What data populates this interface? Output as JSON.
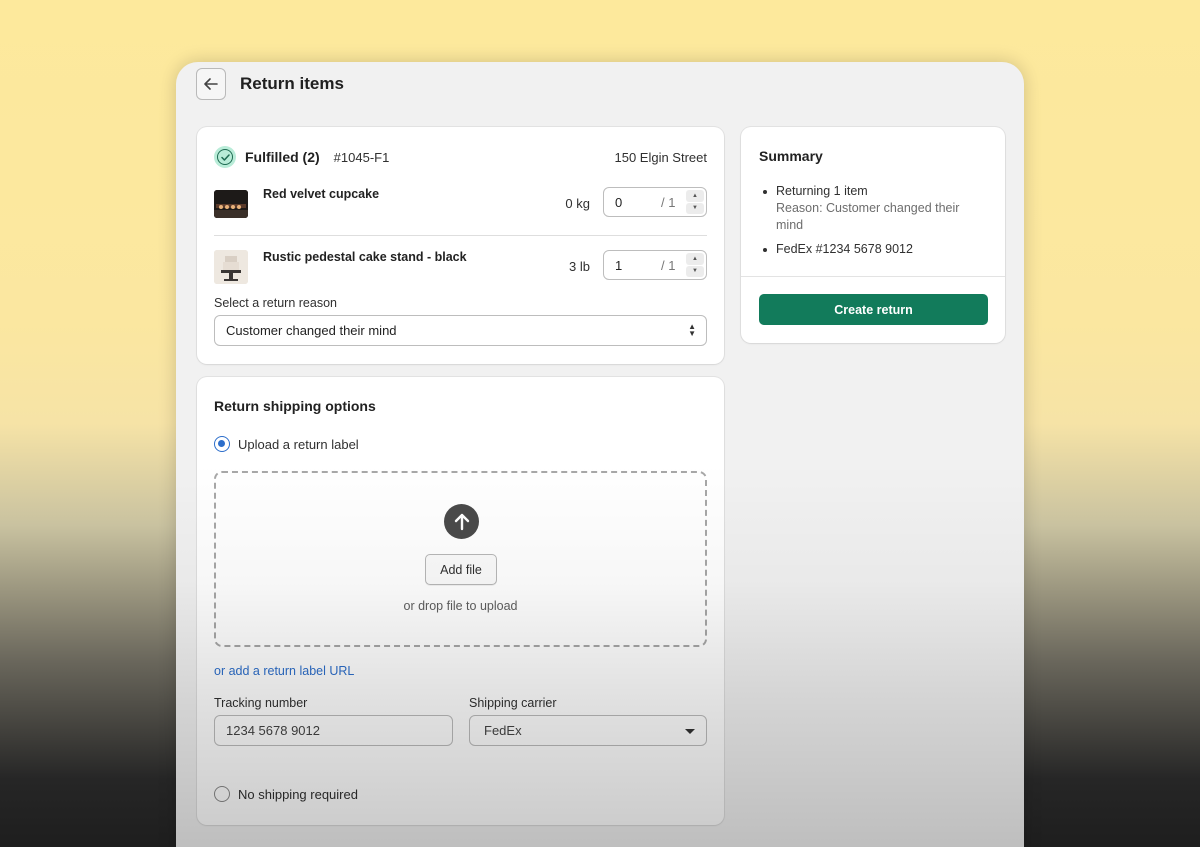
{
  "page": {
    "title": "Return items"
  },
  "fulfillment": {
    "label": "Fulfilled (2)",
    "order": "#1045-F1",
    "address": "150 Elgin Street",
    "items": [
      {
        "name": "Red velvet cupcake",
        "weight": "0 kg",
        "quantity": "0",
        "total": "/ 1"
      },
      {
        "name": "Rustic pedestal cake stand - black",
        "weight": "3 lb",
        "quantity": "1",
        "total": "/ 1"
      }
    ],
    "reason_label": "Select a return reason",
    "reason_value": "Customer changed their mind"
  },
  "shipping": {
    "title": "Return shipping options",
    "upload_option": "Upload a return label",
    "add_file_button": "Add file",
    "drop_hint": "or drop file to upload",
    "url_link": "or add a return label URL",
    "tracking_label": "Tracking number",
    "tracking_value": "1234 5678 9012",
    "carrier_label": "Shipping carrier",
    "carrier_value": "FedEx",
    "no_shipping_option": "No shipping required"
  },
  "summary": {
    "title": "Summary",
    "returning": "Returning 1 item",
    "reason": "Reason: Customer changed their mind",
    "tracking": "FedEx #1234 5678 9012",
    "create_button": "Create return"
  },
  "colors": {
    "primary": "#127b5b",
    "link": "#2c6ecb",
    "success_badge": "#b9ecd8"
  },
  "icons": {
    "back": "arrow-left-icon",
    "fulfilled": "check-circle-icon",
    "upload": "arrow-up-icon"
  }
}
